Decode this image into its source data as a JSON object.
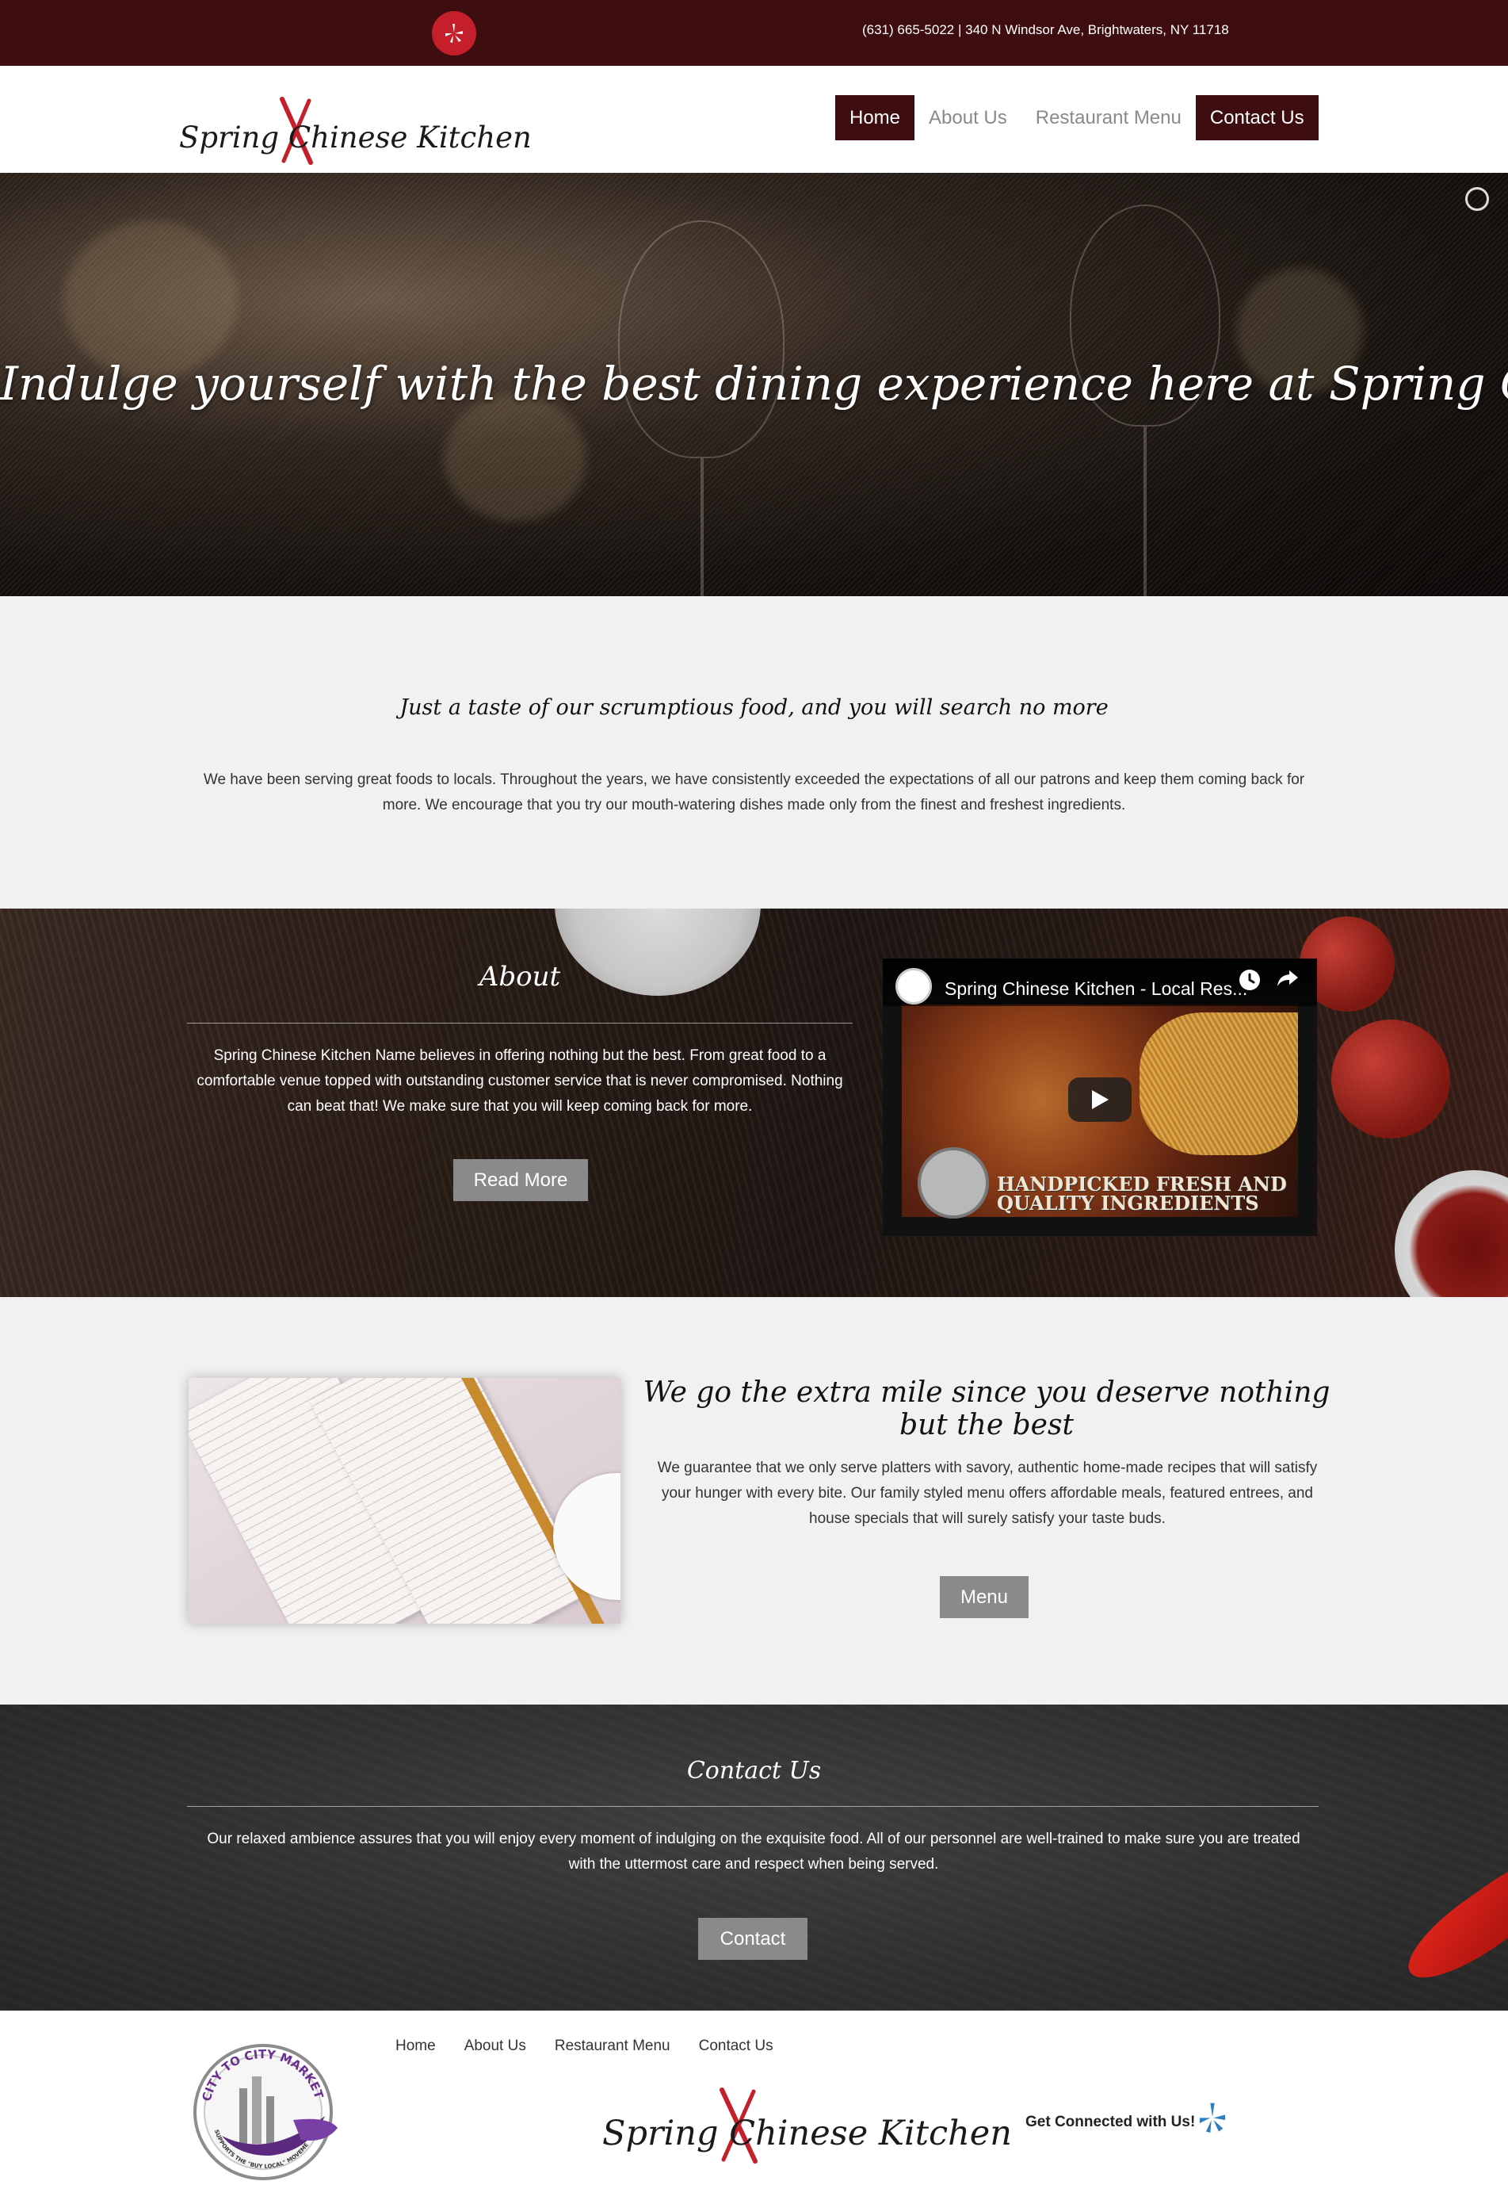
{
  "topbar": {
    "contact_line": "(631) 665-5022 | 340 N Windsor Ave, Brightwaters, NY 11718",
    "social_icon": "yelp-icon"
  },
  "brand": {
    "logo_text": "Spring Chinese Kitchen",
    "accent_color": "#c41f2a",
    "dark_color": "#3d0d0f"
  },
  "nav": {
    "items": [
      {
        "label": "Home",
        "active": true
      },
      {
        "label": "About Us",
        "active": false
      },
      {
        "label": "Restaurant Menu",
        "active": false
      },
      {
        "label": "Contact Us",
        "active": false
      }
    ]
  },
  "hero": {
    "title": "Indulge yourself with the best dining experience here at Spring Chinese Restaurant"
  },
  "intro": {
    "heading": "Just a taste of our scrumptious food, and you will search no more",
    "text": "We have been serving great foods to locals. Throughout the years, we have consistently exceeded the expectations of all our patrons and keep them coming back for more. We encourage that you try our mouth-watering dishes made only from the finest and freshest ingredients."
  },
  "about": {
    "heading": "About",
    "text": "Spring Chinese Kitchen Name believes in offering nothing but the best. From great food to a comfortable venue topped with outstanding customer service that is never compromised. Nothing can beat that! We make sure that you will keep coming back for more.",
    "button": "Read More"
  },
  "video": {
    "title": "Spring Chinese Kitchen - Local Res...",
    "caption_line1": "HANDPICKED FRESH AND",
    "caption_line2": "QUALITY INGREDIENTS"
  },
  "best": {
    "heading": "We go the extra mile since you deserve nothing but the best",
    "text": "We guarantee that we only serve platters with savory, authentic home-made recipes that will satisfy your hunger with every bite. Our family styled menu offers affordable meals, featured entrees, and house specials that will surely satisfy your taste buds.",
    "button": "Menu"
  },
  "contact": {
    "heading": "Contact Us",
    "text": "Our relaxed ambience assures that you will enjoy every moment of indulging on the exquisite food. All of our personnel are well-trained to make sure you are treated with the uttermost care and respect when being served.",
    "button": "Contact"
  },
  "footer": {
    "links": [
      "Home",
      "About Us",
      "Restaurant Menu",
      "Contact Us"
    ],
    "connect_label": "Get Connected with Us!",
    "badge_text_top": "CITY TO CITY MARKET",
    "badge_text_bottom": "SUPPORTS THE \"BUY LOCAL\" MOVEMENT"
  }
}
